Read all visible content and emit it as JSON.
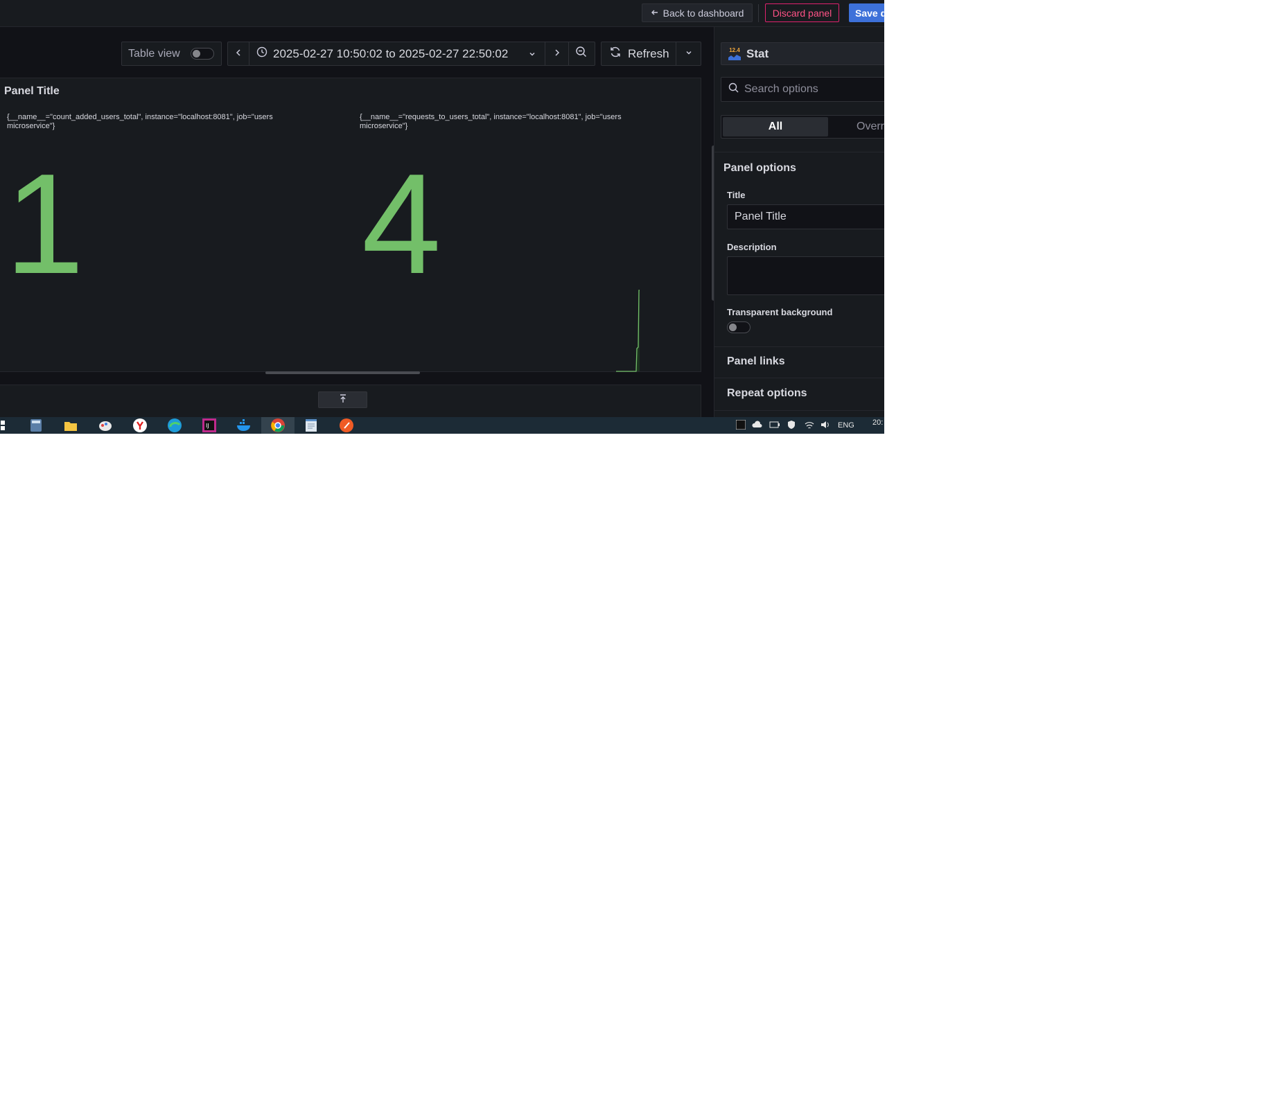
{
  "topbar": {
    "back_label": "Back to dashboard",
    "discard_label": "Discard panel",
    "save_label": "Save d"
  },
  "toolbar": {
    "table_view_label": "Table view",
    "table_view_on": false,
    "time_range": "2025-02-27 10:50:02 to 2025-02-27 22:50:02",
    "refresh_label": "Refresh"
  },
  "panel": {
    "title": "Panel Title",
    "stats": [
      {
        "series_label": "{__name__=\"count_added_users_total\", instance=\"localhost:8081\", job=\"users microservice\"}",
        "value": "1"
      },
      {
        "series_label": "{__name__=\"requests_to_users_total\", instance=\"localhost:8081\", job=\"users microservice\"}",
        "value": "4"
      }
    ],
    "value_color": "#73bf69"
  },
  "sidebar": {
    "viz_version": "12.4",
    "viz_name": "Stat",
    "search_placeholder": "Search options",
    "tabs": [
      "All",
      "Overr"
    ],
    "panel_options_heading": "Panel options",
    "title_label": "Title",
    "title_value": "Panel Title",
    "description_label": "Description",
    "description_value": "",
    "transparent_label": "Transparent background",
    "transparent_on": false,
    "panel_links_label": "Panel links",
    "repeat_options_label": "Repeat options"
  },
  "taskbar": {
    "language": "ENG",
    "clock": "20:"
  },
  "colors": {
    "accent_blue": "#3d71d9",
    "danger_pink": "#ff5286",
    "stat_green": "#73bf69"
  }
}
